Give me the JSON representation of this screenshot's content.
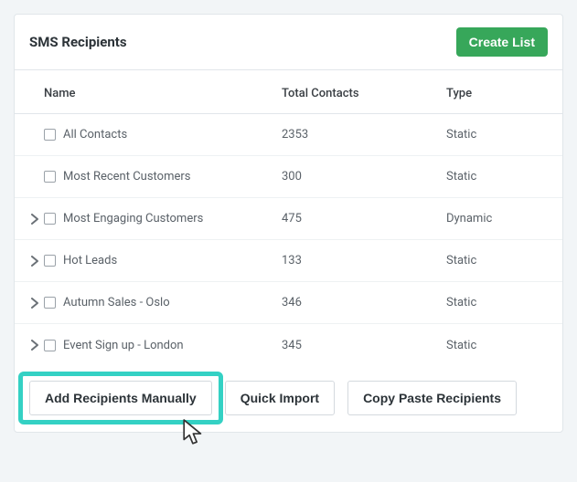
{
  "header": {
    "title": "SMS Recipients",
    "create_label": "Create List"
  },
  "columns": {
    "name": "Name",
    "total": "Total Contacts",
    "type": "Type"
  },
  "rows": [
    {
      "expandable": false,
      "name": "All Contacts",
      "total": "2353",
      "type": "Static"
    },
    {
      "expandable": false,
      "name": "Most Recent Customers",
      "total": "300",
      "type": "Static"
    },
    {
      "expandable": true,
      "name": "Most Engaging Customers",
      "total": "475",
      "type": "Dynamic"
    },
    {
      "expandable": true,
      "name": "Hot Leads",
      "total": "133",
      "type": "Static"
    },
    {
      "expandable": true,
      "name": "Autumn Sales - Oslo",
      "total": "346",
      "type": "Static"
    },
    {
      "expandable": true,
      "name": "Event Sign up - London",
      "total": "345",
      "type": "Static"
    }
  ],
  "footer": {
    "add_manual": "Add Recipients Manually",
    "quick_import": "Quick Import",
    "copy_paste": "Copy Paste Recipients"
  }
}
